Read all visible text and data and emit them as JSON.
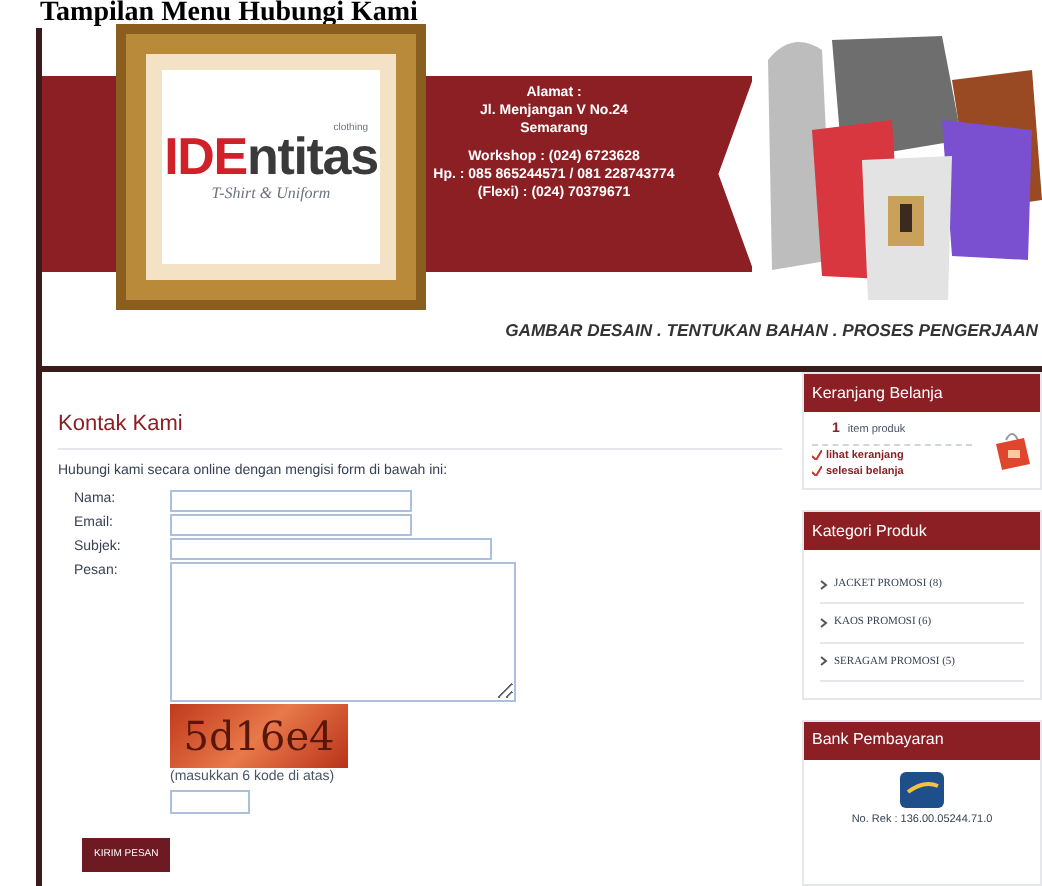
{
  "document_title": "Tampilan Menu Hubungi Kami",
  "header": {
    "logo": {
      "name_highlight": "IDE",
      "name_rest": "ntitas",
      "badge": "clothing",
      "tagline": "T-Shirt & Uniform"
    },
    "address_label": "Alamat :",
    "address_lines": [
      "Jl. Menjangan V No.24",
      "Semarang"
    ],
    "contacts": [
      "Workshop : (024) 6723628",
      "Hp. : 085 865244571 / 081 228743774",
      "(Flexi) : (024) 70379671"
    ],
    "slogan": "GAMBAR DESAIN . TENTUKAN BAHAN . PROSES PENGERJAAN"
  },
  "contact_form": {
    "heading": "Kontak Kami",
    "intro": "Hubungi kami secara online dengan mengisi form di bawah ini:",
    "fields": [
      {
        "label": "Nama:",
        "kind": "short"
      },
      {
        "label": "Email:",
        "kind": "short"
      },
      {
        "label": "Subjek:",
        "kind": "long"
      },
      {
        "label": "Pesan:",
        "kind": "textarea"
      }
    ],
    "captcha": {
      "code": "5d16e4",
      "hint": "(masukkan 6 kode di atas)"
    },
    "submit": "KIRIM PESAN"
  },
  "sidebar": {
    "cart": {
      "title": "Keranjang Belanja",
      "count": "1",
      "count_label": "item produk",
      "links": [
        "lihat keranjang",
        "selesai belanja"
      ]
    },
    "categories": {
      "title": "Kategori Produk",
      "items": [
        "JACKET PROMOSI (8)",
        "KAOS PROMOSI (6)",
        "SERAGAM PROMOSI (5)"
      ]
    },
    "bank": {
      "title": "Bank Pembayaran",
      "account": "No. Rek : 136.00.05244.71.0"
    }
  }
}
